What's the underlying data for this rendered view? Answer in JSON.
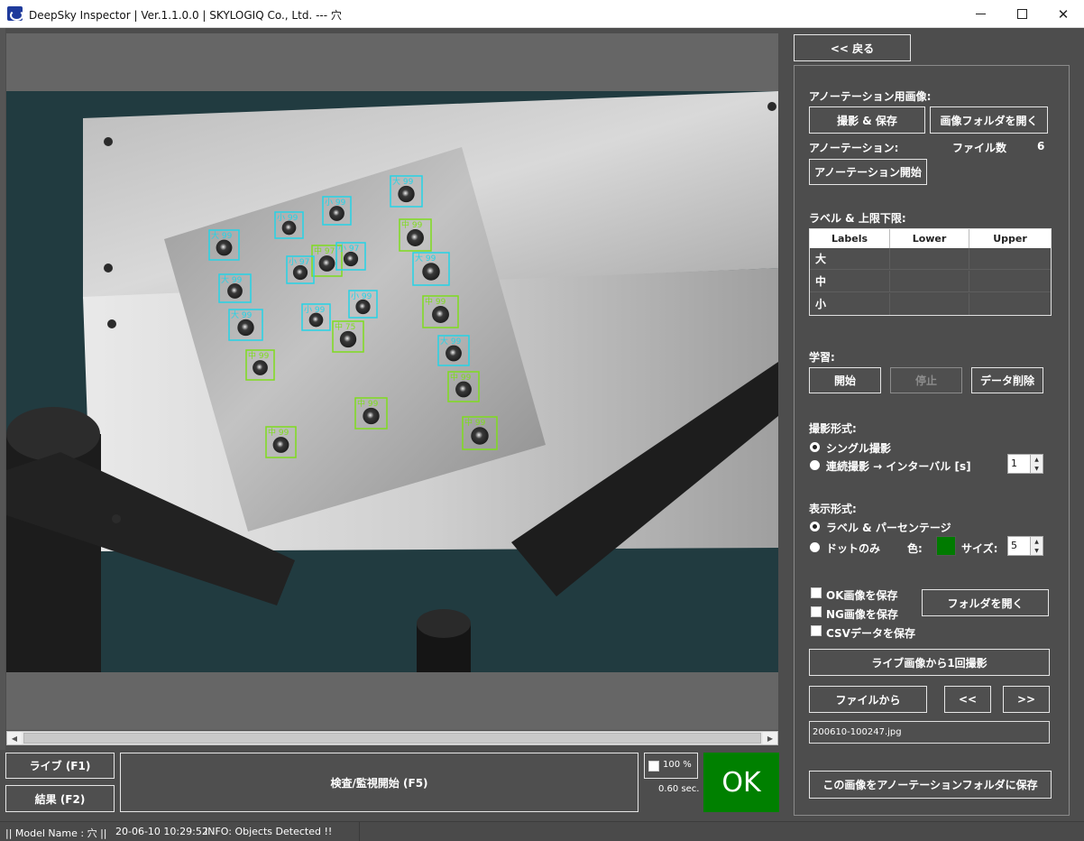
{
  "window": {
    "title": "DeepSky Inspector | Ver.1.1.0.0 | SKYLOGIQ Co., Ltd. --- 穴"
  },
  "image_view": {
    "detections": [
      {
        "label": "大",
        "conf": "99",
        "color": "cyan"
      },
      {
        "label": "小",
        "conf": "99",
        "color": "cyan"
      },
      {
        "label": "大",
        "conf": "99",
        "color": "cyan"
      },
      {
        "label": "小",
        "conf": "99",
        "color": "cyan"
      },
      {
        "label": "中",
        "conf": "99",
        "color": "lime"
      },
      {
        "label": "大",
        "conf": "99",
        "color": "cyan"
      },
      {
        "label": "中",
        "conf": "97",
        "color": "lime"
      },
      {
        "label": "小",
        "conf": "97",
        "color": "cyan"
      },
      {
        "label": "小",
        "conf": "97",
        "color": "cyan"
      },
      {
        "label": "大",
        "conf": "99",
        "color": "cyan"
      },
      {
        "label": "中",
        "conf": "99",
        "color": "lime"
      },
      {
        "label": "小",
        "conf": "99",
        "color": "cyan"
      },
      {
        "label": "大",
        "conf": "99",
        "color": "cyan"
      },
      {
        "label": "小",
        "conf": "99",
        "color": "cyan"
      },
      {
        "label": "中",
        "conf": "75",
        "color": "lime"
      },
      {
        "label": "中",
        "conf": "99",
        "color": "lime"
      },
      {
        "label": "大",
        "conf": "99",
        "color": "cyan"
      },
      {
        "label": "中",
        "conf": "99",
        "color": "lime"
      },
      {
        "label": "中",
        "conf": "99",
        "color": "lime"
      },
      {
        "label": "中",
        "conf": "99",
        "color": "lime"
      },
      {
        "label": "中",
        "conf": "99",
        "color": "lime"
      },
      {
        "label": "大",
        "conf": "99",
        "color": "cyan"
      }
    ]
  },
  "bottom": {
    "live_label": "ライブ (F1)",
    "result_label": "結果 (F2)",
    "inspect_label": "検査/監視開始 (F5)",
    "zoom_text": "100 %",
    "time_text": "0.60 sec.",
    "ok_text": "OK"
  },
  "status": {
    "model": "|| Model Name : 穴 ||",
    "datetime": "20-06-10 10:29:52",
    "info": "INFO:   Objects Detected !!"
  },
  "panel": {
    "back_label": "<< 戻る",
    "annotation_image_heading": "アノーテーション用画像:",
    "capture_save_label": "撮影 & 保存",
    "open_image_folder_label": "画像フォルダを開く",
    "annotation_heading": "アノーテーション:",
    "file_count_label": "ファイル数",
    "file_count_value": "6",
    "annotation_start_label": "アノーテーション開始",
    "limits_heading": "ラベル & 上限下限:",
    "table_headers": [
      "Labels",
      "Lower",
      "Upper"
    ],
    "table_rows": [
      {
        "label": "大",
        "lower": "",
        "upper": ""
      },
      {
        "label": "中",
        "lower": "",
        "upper": ""
      },
      {
        "label": "小",
        "lower": "",
        "upper": ""
      }
    ],
    "learning_heading": "学習:",
    "learn_start_label": "開始",
    "learn_stop_label": "停止",
    "data_delete_label": "データ削除",
    "capture_mode_heading": "撮影形式:",
    "single_capture_label": "シングル撮影",
    "continuous_capture_label": "連続撮影 → インターバル [s]",
    "interval_value": "1",
    "display_mode_heading": "表示形式:",
    "label_percentage_label": "ラベル & パーセンテージ",
    "dots_only_label": "ドットのみ",
    "color_label": "色:",
    "size_label": "サイズ:",
    "size_value": "5",
    "dot_color": "#007a00",
    "save_ok_label": "OK画像を保存",
    "save_ng_label": "NG画像を保存",
    "save_csv_label": "CSVデータを保存",
    "open_folder_label": "フォルダを開く",
    "capture_once_label": "ライブ画像から1回撮影",
    "from_file_label": "ファイルから",
    "prev_label": "<<",
    "next_label": ">>",
    "file_name": "200610-100247.jpg",
    "save_to_annotation_label": "この画像をアノーテーションフォルダに保存"
  }
}
